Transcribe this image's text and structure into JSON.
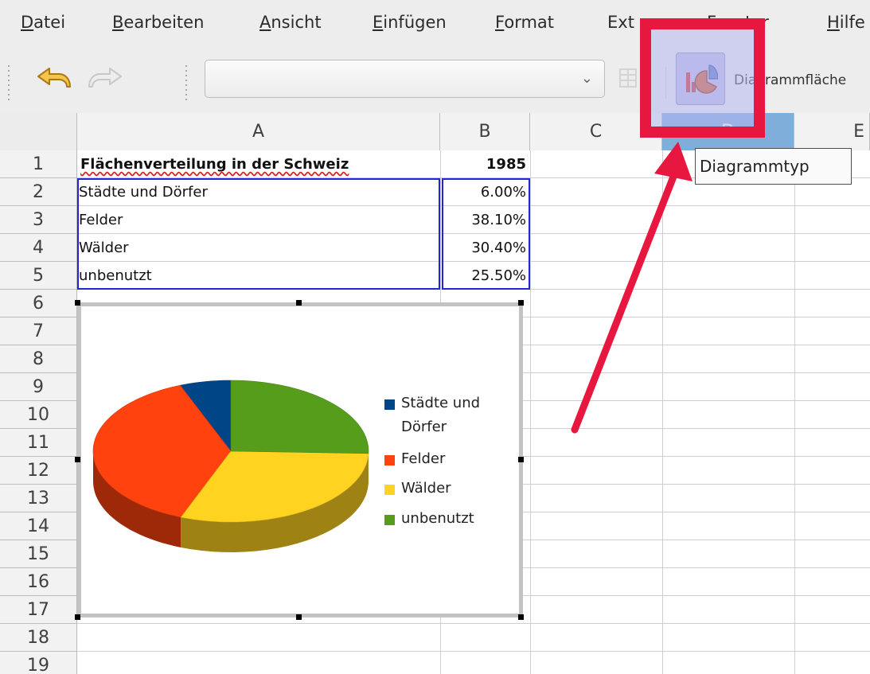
{
  "menu": [
    {
      "label": "Datei",
      "accel": "D",
      "rest": "atei"
    },
    {
      "label": "Bearbeiten",
      "accel": "B",
      "rest": "earbeiten"
    },
    {
      "label": "Ansicht",
      "accel": "A",
      "rest": "nsicht"
    },
    {
      "label": "Einfügen",
      "accel": "E",
      "rest": "infügen"
    },
    {
      "label": "Format",
      "accel": "F",
      "rest": "ormat"
    },
    {
      "label": "Extras",
      "accel": "",
      "rest": "Ext as"
    },
    {
      "label": "Fenster",
      "accel": "",
      "rest": "Fenster"
    },
    {
      "label": "Hilfe",
      "accel": "H",
      "rest": "ilfe"
    }
  ],
  "toolbar": {
    "undo_icon": "undo-icon",
    "redo_icon": "redo-icon",
    "name_box_value": "",
    "chart_type_icon": "chart-type-icon",
    "label": "Diagrammfläche"
  },
  "columns": [
    "A",
    "B",
    "C",
    "D",
    "E"
  ],
  "rows": [
    "1",
    "2",
    "3",
    "4",
    "5",
    "6",
    "7",
    "8",
    "9",
    "10",
    "11",
    "12",
    "13",
    "14",
    "15",
    "16",
    "17",
    "18",
    "19"
  ],
  "sheet": {
    "title": "Flächenverteilung in der Schweiz",
    "year": "1985",
    "data": [
      {
        "label": "Städte und Dörfer",
        "value": "6.00%"
      },
      {
        "label": "Felder",
        "value": "38.10%"
      },
      {
        "label": "Wälder",
        "value": "30.40%"
      },
      {
        "label": "unbenutzt",
        "value": "25.50%"
      }
    ]
  },
  "chart_data": {
    "type": "pie",
    "title": "",
    "categories": [
      "Städte und Dörfer",
      "Felder",
      "Wälder",
      "unbenutzt"
    ],
    "values": [
      6.0,
      38.1,
      30.4,
      25.5
    ],
    "colors": [
      "#004586",
      "#ff420e",
      "#ffd320",
      "#579d1c"
    ],
    "three_d": true,
    "legend": "right",
    "legend_lines": [
      [
        "Städte und",
        "Dörfer"
      ],
      [
        "Felder"
      ],
      [
        "Wälder"
      ],
      [
        "unbenutzt"
      ]
    ]
  },
  "tooltip": "Diagrammtyp",
  "colors": {
    "highlight": "#e8173f",
    "selection": "#2424d8",
    "button_overlay": "#b6b6f2"
  }
}
